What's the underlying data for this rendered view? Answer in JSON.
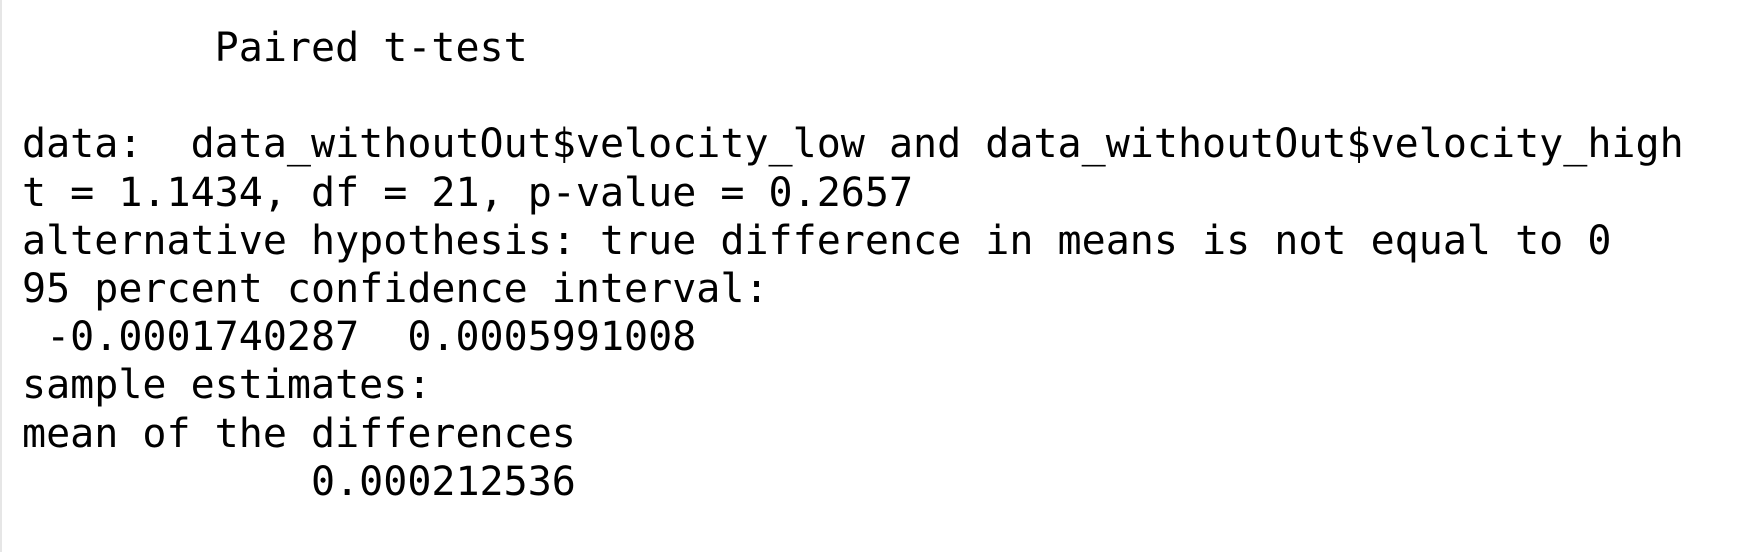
{
  "console": {
    "lines": [
      "        Paired t-test",
      "",
      "data:  data_withoutOut$velocity_low and data_withoutOut$velocity_high",
      "t = 1.1434, df = 21, p-value = 0.2657",
      "alternative hypothesis: true difference in means is not equal to 0",
      "95 percent confidence interval:",
      " -0.0001740287  0.0005991008",
      "sample estimates:",
      "mean of the differences",
      "            0.000212536"
    ]
  }
}
